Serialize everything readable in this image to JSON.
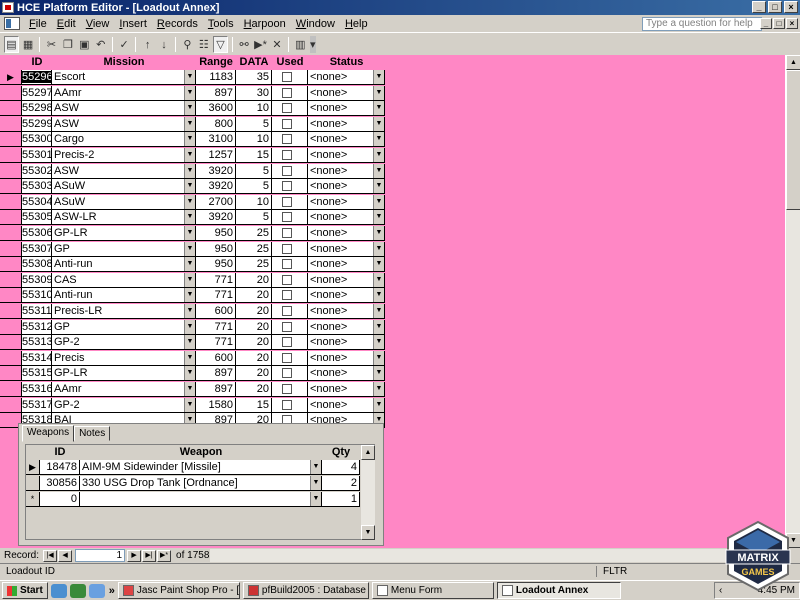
{
  "window": {
    "title": "HCE Platform Editor - [Loadout Annex]",
    "controls": [
      "_",
      "□",
      "×"
    ]
  },
  "menubar": {
    "items": [
      {
        "label": "File",
        "u": "F",
        "rest": "ile"
      },
      {
        "label": "Edit",
        "u": "E",
        "rest": "dit"
      },
      {
        "label": "View",
        "u": "V",
        "rest": "iew"
      },
      {
        "label": "Insert",
        "u": "I",
        "rest": "nsert"
      },
      {
        "label": "Records",
        "u": "R",
        "rest": "ecords"
      },
      {
        "label": "Tools",
        "u": "T",
        "rest": "ools"
      },
      {
        "label": "Harpoon",
        "u": "H",
        "rest": "arpoon"
      },
      {
        "label": "Window",
        "u": "W",
        "rest": "indow"
      },
      {
        "label": "Help",
        "u": "H",
        "rest": "elp"
      }
    ],
    "help_placeholder": "Type a question for help",
    "doc_controls": [
      "_",
      "□",
      "×"
    ]
  },
  "toolbar": {
    "buttons": [
      "design-view-icon",
      "datasheet-icon",
      "cut-icon",
      "copy-icon",
      "paste-icon",
      "undo-icon",
      "spelling-icon",
      "sort-asc-icon",
      "sort-desc-icon",
      "filter-by-selection-icon",
      "filter-by-form-icon",
      "apply-filter-icon",
      "find-icon",
      "new-record-icon",
      "delete-record-icon",
      "database-window-icon",
      "more-icon"
    ]
  },
  "datasheet": {
    "columns": {
      "id": "ID",
      "mission": "Mission",
      "range": "Range",
      "data": "DATA",
      "used": "Used",
      "status": "Status"
    },
    "rows": [
      {
        "id": "55296",
        "mission": "Escort",
        "range": "1183",
        "data": "35",
        "status": "<none>",
        "current": true
      },
      {
        "id": "55297",
        "mission": "AAmr",
        "range": "897",
        "data": "30",
        "status": "<none>"
      },
      {
        "id": "55298",
        "mission": "ASW",
        "range": "3600",
        "data": "10",
        "status": "<none>"
      },
      {
        "id": "55299",
        "mission": "ASW",
        "range": "800",
        "data": "5",
        "status": "<none>"
      },
      {
        "id": "55300",
        "mission": "Cargo",
        "range": "3100",
        "data": "10",
        "status": "<none>"
      },
      {
        "id": "55301",
        "mission": "Precis-2",
        "range": "1257",
        "data": "15",
        "status": "<none>"
      },
      {
        "id": "55302",
        "mission": "ASW",
        "range": "3920",
        "data": "5",
        "status": "<none>"
      },
      {
        "id": "55303",
        "mission": "ASuW",
        "range": "3920",
        "data": "5",
        "status": "<none>"
      },
      {
        "id": "55304",
        "mission": "ASuW",
        "range": "2700",
        "data": "10",
        "status": "<none>"
      },
      {
        "id": "55305",
        "mission": "ASW-LR",
        "range": "3920",
        "data": "5",
        "status": "<none>"
      },
      {
        "id": "55306",
        "mission": "GP-LR",
        "range": "950",
        "data": "25",
        "status": "<none>"
      },
      {
        "id": "55307",
        "mission": "GP",
        "range": "950",
        "data": "25",
        "status": "<none>"
      },
      {
        "id": "55308",
        "mission": "Anti-run",
        "range": "950",
        "data": "25",
        "status": "<none>"
      },
      {
        "id": "55309",
        "mission": "CAS",
        "range": "771",
        "data": "20",
        "status": "<none>"
      },
      {
        "id": "55310",
        "mission": "Anti-run",
        "range": "771",
        "data": "20",
        "status": "<none>"
      },
      {
        "id": "55311",
        "mission": "Precis-LR",
        "range": "600",
        "data": "20",
        "status": "<none>"
      },
      {
        "id": "55312",
        "mission": "GP",
        "range": "771",
        "data": "20",
        "status": "<none>"
      },
      {
        "id": "55313",
        "mission": "GP-2",
        "range": "771",
        "data": "20",
        "status": "<none>"
      },
      {
        "id": "55314",
        "mission": "Precis",
        "range": "600",
        "data": "20",
        "status": "<none>"
      },
      {
        "id": "55315",
        "mission": "GP-LR",
        "range": "897",
        "data": "20",
        "status": "<none>"
      },
      {
        "id": "55316",
        "mission": "AAmr",
        "range": "897",
        "data": "20",
        "status": "<none>"
      },
      {
        "id": "55317",
        "mission": "GP-2",
        "range": "1580",
        "data": "15",
        "status": "<none>"
      },
      {
        "id": "55318",
        "mission": "BAI",
        "range": "897",
        "data": "20",
        "status": "<none>"
      }
    ]
  },
  "subform": {
    "tabs": [
      "Weapons",
      "Notes"
    ],
    "columns": {
      "id": "ID",
      "weapon": "Weapon",
      "qty": "Qty"
    },
    "rows": [
      {
        "id": "18478",
        "weapon": "AIM-9M Sidewinder [Missile]",
        "qty": "4",
        "marker": "▶"
      },
      {
        "id": "30856",
        "weapon": "330 USG Drop Tank [Ordnance]",
        "qty": "2",
        "marker": ""
      },
      {
        "id": "0",
        "weapon": "",
        "qty": "1",
        "marker": "*"
      }
    ]
  },
  "navigation": {
    "label": "Record:",
    "current": "1",
    "of_text": "of 1758"
  },
  "statusbar": {
    "text": "Loadout ID",
    "filter": "FLTR"
  },
  "taskbar": {
    "start": "Start",
    "tasks": [
      {
        "label": "Jasc Paint Shop Pro - [Im...",
        "active": false
      },
      {
        "label": "pfBuild2005 : Database (...",
        "active": false
      },
      {
        "label": "Menu Form",
        "active": false
      },
      {
        "label": "Loadout Annex",
        "active": true
      }
    ],
    "clock": "4:45 PM",
    "chevron": "»"
  },
  "colors": {
    "accent": "#ff87c5",
    "titlebar": "#0a246a",
    "chrome": "#d4d0c8"
  },
  "logo": {
    "text": [
      "MATRIX",
      "GAMES"
    ]
  }
}
